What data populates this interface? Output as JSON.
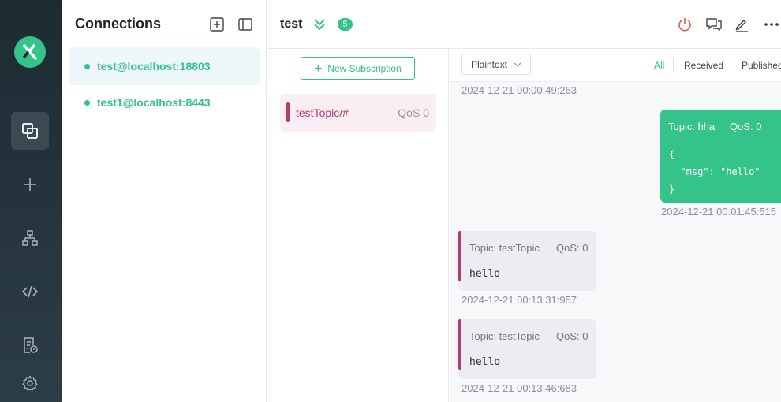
{
  "sidebar": {
    "nav": [
      {
        "icon": "connections-icon",
        "active": true
      },
      {
        "icon": "plus-icon",
        "active": false
      },
      {
        "icon": "topology-icon",
        "active": false
      },
      {
        "icon": "code-icon",
        "active": false
      },
      {
        "icon": "log-icon",
        "active": false
      },
      {
        "icon": "gear-icon",
        "active": false
      }
    ]
  },
  "connections": {
    "title": "Connections",
    "items": [
      {
        "label": "test@localhost:18803",
        "active": true
      },
      {
        "label": "test1@localhost:8443",
        "active": false
      }
    ]
  },
  "header": {
    "name": "test",
    "count": "5"
  },
  "subscriptions": {
    "new_label": "New Subscription",
    "items": [
      {
        "topic": "testTopic/#",
        "qos": "QoS 0",
        "color": "#b23a75"
      }
    ]
  },
  "messages": {
    "format": "Plaintext",
    "filters": [
      "All",
      "Received",
      "Published"
    ],
    "top_timestamp": "2024-12-21 00:00:49:263",
    "published": {
      "topic": "Topic: hha",
      "qos": "QoS: 0",
      "payload": "{\n  \"msg\": \"hello\"\n}",
      "timestamp": "2024-12-21 00:01:45:515"
    },
    "received": [
      {
        "topic": "Topic: testTopic",
        "qos": "QoS: 0",
        "payload": "hello",
        "timestamp": "2024-12-21 00:13:31:957"
      },
      {
        "topic": "Topic: testTopic",
        "qos": "QoS: 0",
        "payload": "hello",
        "timestamp": "2024-12-21 00:13:46:683"
      }
    ]
  },
  "colors": {
    "accent": "#34c388",
    "topic": "#b23a75",
    "rail": "#1d2b33",
    "danger": "#e05a4f"
  }
}
